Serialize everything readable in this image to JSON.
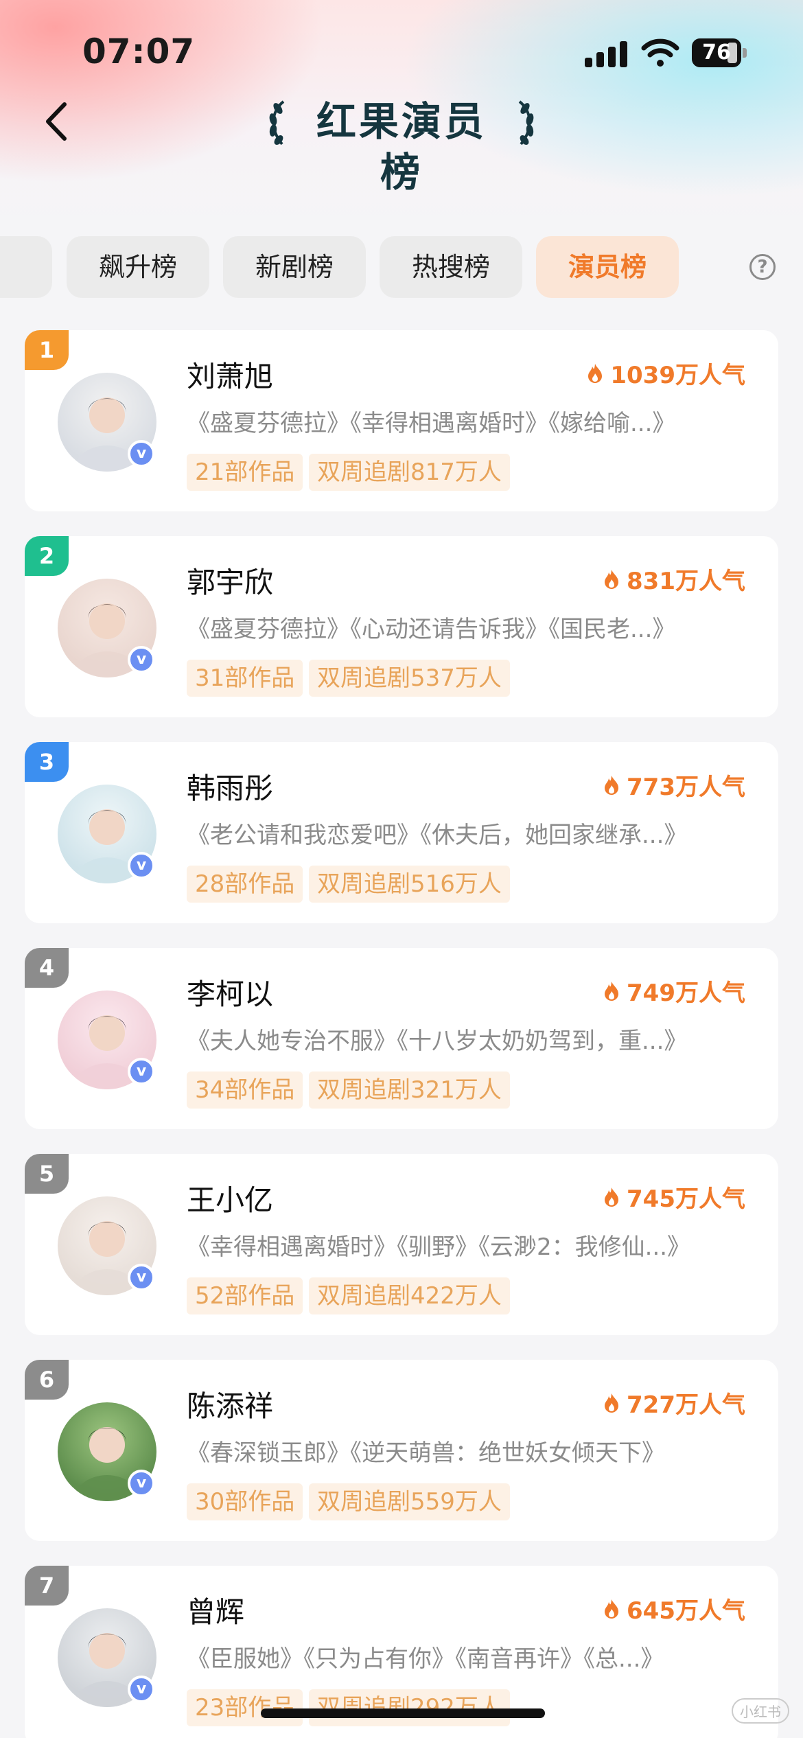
{
  "status": {
    "time": "07:07",
    "battery": "76"
  },
  "header": {
    "title": "红果演员榜",
    "back_icon": "chevron-left-icon"
  },
  "tabs": [
    {
      "label": "",
      "active": false
    },
    {
      "label": "飙升榜",
      "active": false
    },
    {
      "label": "新剧榜",
      "active": false
    },
    {
      "label": "热搜榜",
      "active": false
    },
    {
      "label": "演员榜",
      "active": true
    }
  ],
  "help": {
    "label": "?"
  },
  "colors": {
    "accent": "#f07a2a",
    "rank1": "#f59a2f",
    "rank2": "#1fbf8f",
    "rank3": "#3c8ff0",
    "rank_other": "#8c8c8c"
  },
  "actors": [
    {
      "rank": "1",
      "name": "刘萧旭",
      "popularity": "1039万人气",
      "works": "《盛夏芬德拉》《幸得相遇离婚时》《嫁给喻...》",
      "count": "21部作品",
      "follow": "双周追剧817万人",
      "verified": "v"
    },
    {
      "rank": "2",
      "name": "郭宇欣",
      "popularity": "831万人气",
      "works": "《盛夏芬德拉》《心动还请告诉我》《国民老...》",
      "count": "31部作品",
      "follow": "双周追剧537万人",
      "verified": "v"
    },
    {
      "rank": "3",
      "name": "韩雨彤",
      "popularity": "773万人气",
      "works": "《老公请和我恋爱吧》《休夫后，她回家继承...》",
      "count": "28部作品",
      "follow": "双周追剧516万人",
      "verified": "v"
    },
    {
      "rank": "4",
      "name": "李柯以",
      "popularity": "749万人气",
      "works": "《夫人她专治不服》《十八岁太奶奶驾到，重...》",
      "count": "34部作品",
      "follow": "双周追剧321万人",
      "verified": "v"
    },
    {
      "rank": "5",
      "name": "王小亿",
      "popularity": "745万人气",
      "works": "《幸得相遇离婚时》《驯野》《云渺2：我修仙...》",
      "count": "52部作品",
      "follow": "双周追剧422万人",
      "verified": "v"
    },
    {
      "rank": "6",
      "name": "陈添祥",
      "popularity": "727万人气",
      "works": "《春深锁玉郎》《逆天萌兽：绝世妖女倾天下》",
      "count": "30部作品",
      "follow": "双周追剧559万人",
      "verified": "v"
    },
    {
      "rank": "7",
      "name": "曾辉",
      "popularity": "645万人气",
      "works": "《臣服她》《只为占有你》《南音再许》《总...》",
      "count": "23部作品",
      "follow": "双周追剧292万人",
      "verified": "v"
    }
  ]
}
